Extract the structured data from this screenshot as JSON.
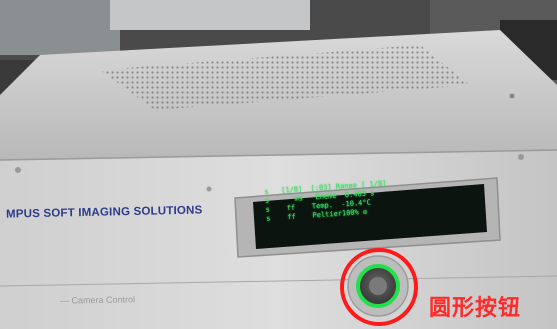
{
  "scene": {
    "description_colors": {
      "chassis": "#c9c9c9",
      "front_panel": "#d4d4d4",
      "lcd_bg": "#0c1410",
      "lcd_text": "#44e06a",
      "button_ring": "#22e04a",
      "highlight_circle": "#ff1a1a",
      "brand_text": "#2a3c8a"
    }
  },
  "brand_text": "MPUS SOFT IMAGING SOLUTIONS",
  "footer_label": "— Camera Control",
  "lcd": {
    "lines": [
      "s   [1/8]  [:03] Range [ 1/8]",
      "s      ms   Eneme  0.483 s",
      "s    ff    Temp.  -10.4°C",
      "s    ff    Peltier100% ◎"
    ]
  },
  "annotation": {
    "label": "圆形按钮"
  }
}
